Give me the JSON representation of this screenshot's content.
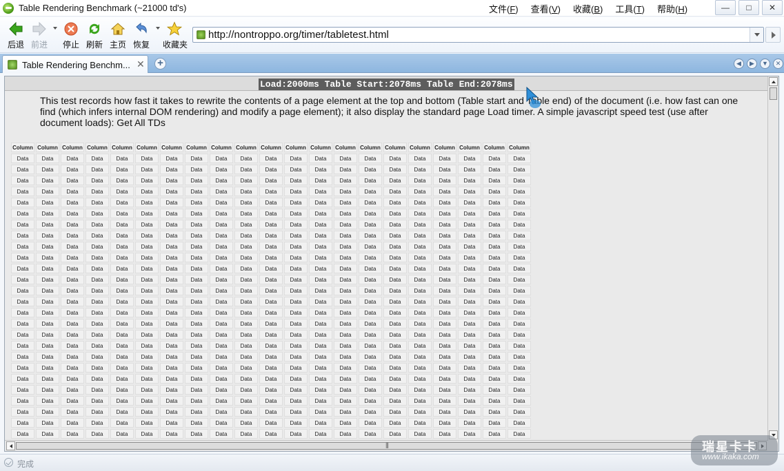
{
  "window": {
    "title": "Table Rendering Benchmark (~21000 td's)",
    "menus": [
      {
        "label": "文件(",
        "key": "F",
        "end": ")"
      },
      {
        "label": "查看(",
        "key": "V",
        "end": ")"
      },
      {
        "label": "收藏(",
        "key": "B",
        "end": ")"
      },
      {
        "label": "工具(",
        "key": "T",
        "end": ")"
      },
      {
        "label": "帮助(",
        "key": "H",
        "end": ")"
      }
    ]
  },
  "toolbar": {
    "back_label": "后退",
    "forward_label": "前进",
    "stop_label": "停止",
    "refresh_label": "刷新",
    "home_label": "主页",
    "restore_label": "恢复",
    "favorites_label": "收藏夹"
  },
  "address": {
    "url": "http://nontroppo.org/timer/tabletest.html"
  },
  "tabs": {
    "active_label": "Table Rendering Benchm...",
    "close_glyph": "✕",
    "new_tab_glyph": "+"
  },
  "page": {
    "timer_text": "Load:2000ms Table Start:2078ms Table End:2078ms",
    "description": "This test records how fast it takes to rewrite the contents of a page element at the top and bottom (Table start and Table end) of the document (i.e. how fast can one find (which infers internal DOM rendering) and modify a page element); it also display the standard page Load timer. A simple javascript speed test (use after document loads): Get All TDs",
    "table": {
      "header_label": "Column",
      "cell_label": "Data",
      "visible_columns": 21,
      "visible_rows": 26
    },
    "hscroll_grip": "|||"
  },
  "status": {
    "text": "完成"
  },
  "watermark": {
    "title": "瑞星卡卡",
    "url": "www.ikaka.com"
  },
  "colors": {
    "timer_bg": "#5d5d5d",
    "tabbar_bg": "#8db6df",
    "back_green": "#3aa51c"
  }
}
